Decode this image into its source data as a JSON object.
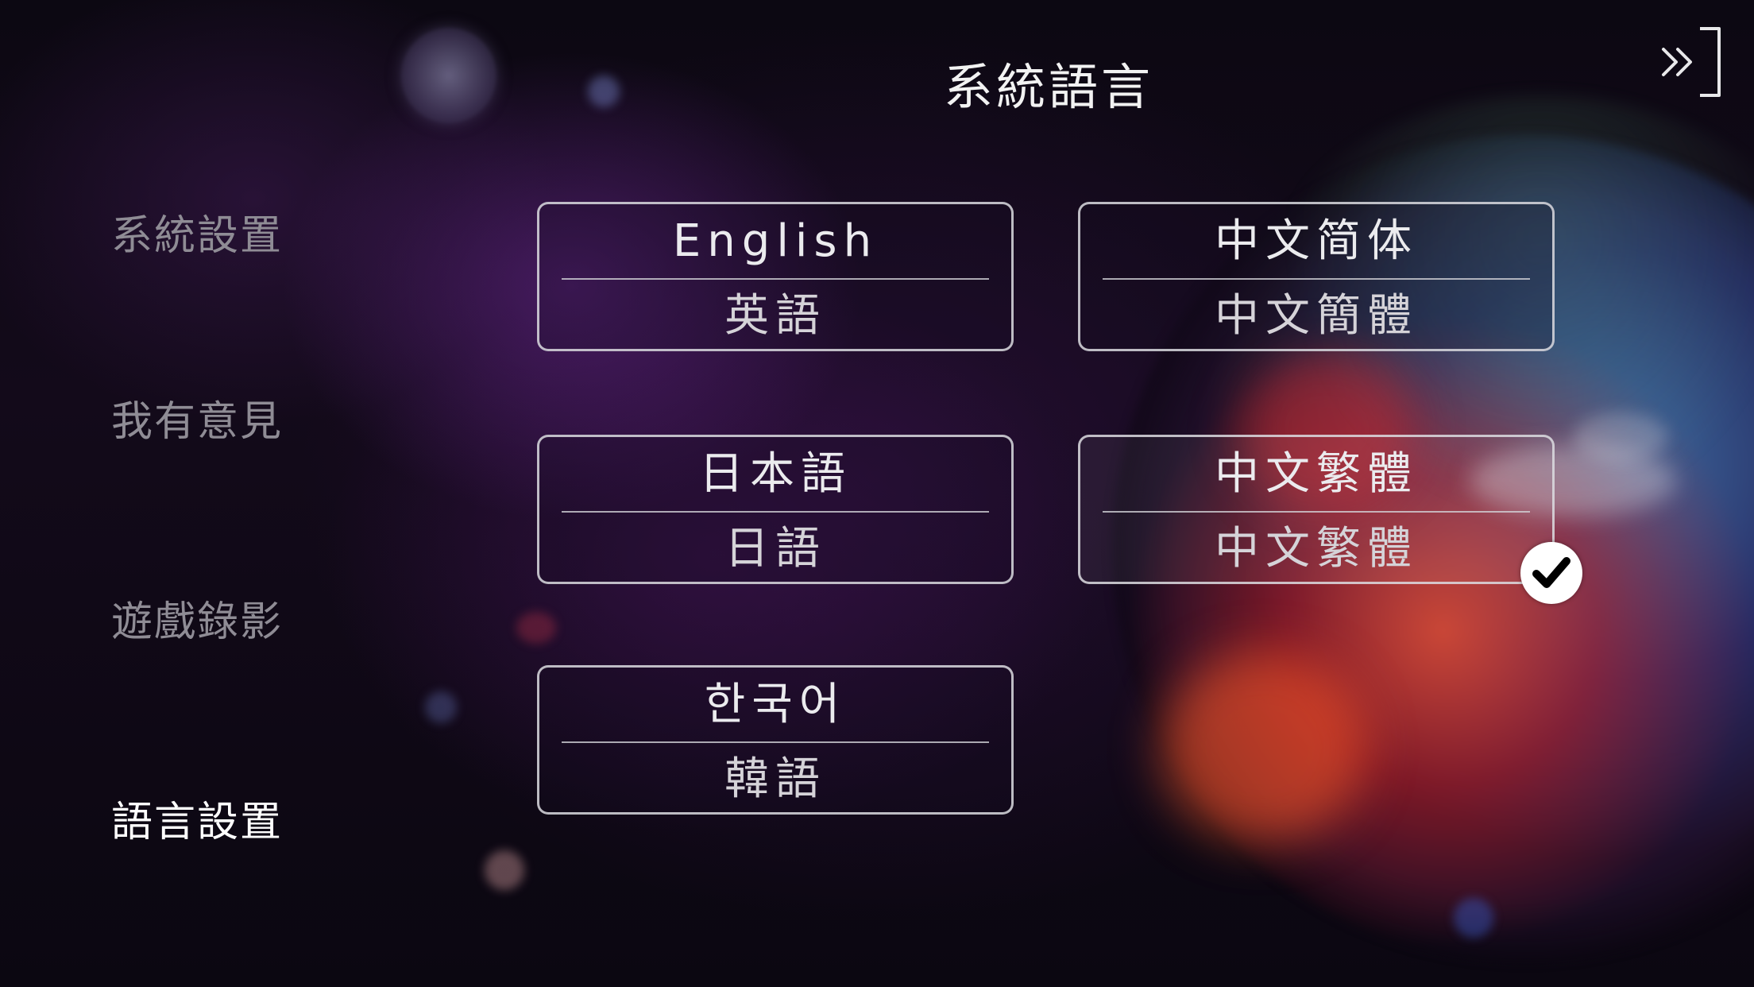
{
  "header": {
    "title": "系統語言"
  },
  "sidebar": {
    "items": [
      {
        "label": "系統設置",
        "active": false
      },
      {
        "label": "我有意見",
        "active": false
      },
      {
        "label": "遊戲錄影",
        "active": false
      },
      {
        "label": "語言設置",
        "active": true
      }
    ]
  },
  "languages": [
    {
      "native": "English",
      "local": "英語",
      "selected": false
    },
    {
      "native": "中文简体",
      "local": "中文簡體",
      "selected": false
    },
    {
      "native": "日本語",
      "local": "日語",
      "selected": false
    },
    {
      "native": "中文繁體",
      "local": "中文繁體",
      "selected": true
    },
    {
      "native": "한국어",
      "local": "韓語",
      "selected": false
    }
  ],
  "icons": {
    "exit": "exit-icon",
    "selected_check": "checkmark-icon"
  },
  "colors": {
    "text_primary": "#ffffff",
    "text_muted": "#8f8c95",
    "card_border": "#dcdce1"
  }
}
